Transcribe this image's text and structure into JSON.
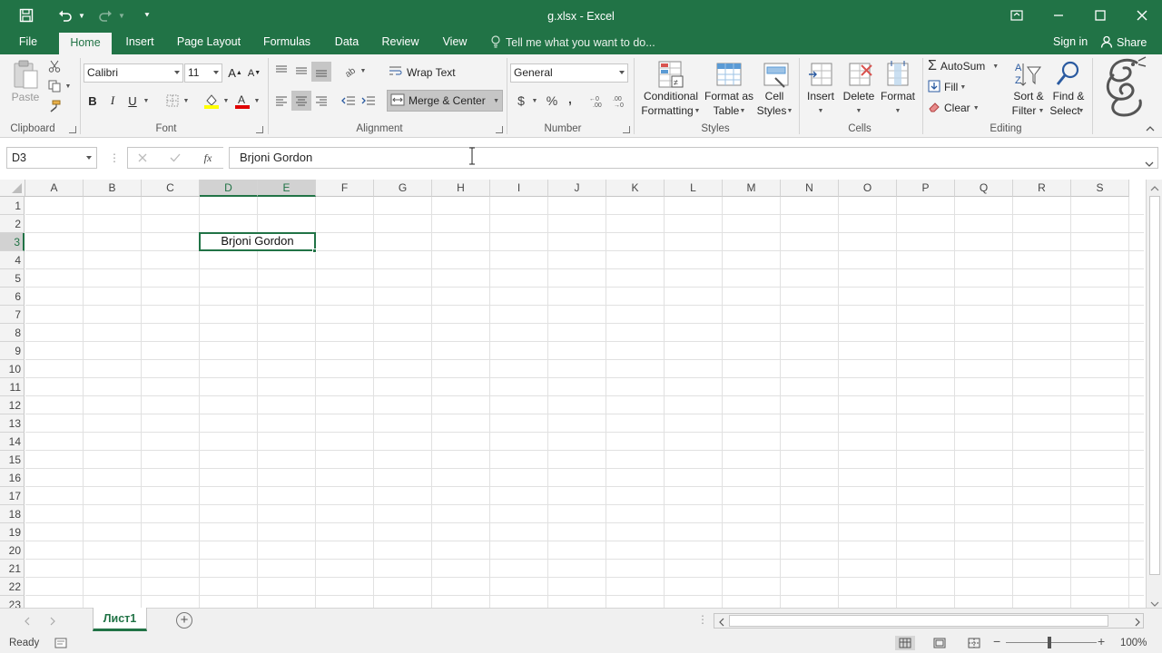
{
  "window": {
    "title": "g.xlsx - Excel"
  },
  "tabs": [
    "File",
    "Home",
    "Insert",
    "Page Layout",
    "Formulas",
    "Data",
    "Review",
    "View"
  ],
  "tell_me": "Tell me what you want to do...",
  "account": {
    "sign_in": "Sign in",
    "share": "Share"
  },
  "ribbon": {
    "clipboard": {
      "paste": "Paste",
      "label": "Clipboard"
    },
    "font": {
      "name": "Calibri",
      "size": "11",
      "label": "Font",
      "bold": "B",
      "italic": "I",
      "underline": "U"
    },
    "alignment": {
      "wrap": "Wrap Text",
      "merge": "Merge & Center",
      "label": "Alignment"
    },
    "number": {
      "format": "General",
      "currency": "$",
      "percent": "%",
      "comma": ",",
      "label": "Number"
    },
    "styles": {
      "cond1": "Conditional",
      "cond2": "Formatting",
      "fmt1": "Format as",
      "fmt2": "Table",
      "cell1": "Cell",
      "cell2": "Styles",
      "label": "Styles"
    },
    "cells": {
      "insert": "Insert",
      "delete": "Delete",
      "format": "Format",
      "label": "Cells"
    },
    "editing": {
      "autosum": "AutoSum",
      "fill": "Fill",
      "clear": "Clear",
      "sort1": "Sort &",
      "sort2": "Filter",
      "find1": "Find &",
      "find2": "Select",
      "label": "Editing"
    }
  },
  "formula_bar": {
    "name_box": "D3",
    "fx": "fx",
    "content": "Brjoni Gordon"
  },
  "grid": {
    "columns": [
      "A",
      "B",
      "C",
      "D",
      "E",
      "F",
      "G",
      "H",
      "I",
      "J",
      "K",
      "L",
      "M",
      "N",
      "O",
      "P",
      "Q",
      "R",
      "S"
    ],
    "rows": [
      "1",
      "2",
      "3",
      "4",
      "5",
      "6",
      "7",
      "8",
      "9",
      "10",
      "11",
      "12",
      "13",
      "14",
      "15",
      "16",
      "17",
      "18",
      "19",
      "20",
      "21",
      "22",
      "23"
    ],
    "selected_column": "D",
    "selected_row": "3",
    "cell_d3": "Brjoni Gordon"
  },
  "sheet_tab": "Лист1",
  "status": {
    "ready": "Ready",
    "zoom": "100%"
  },
  "colors": {
    "excel_green": "#217346",
    "ribbon_bg": "#f3f3f3"
  }
}
